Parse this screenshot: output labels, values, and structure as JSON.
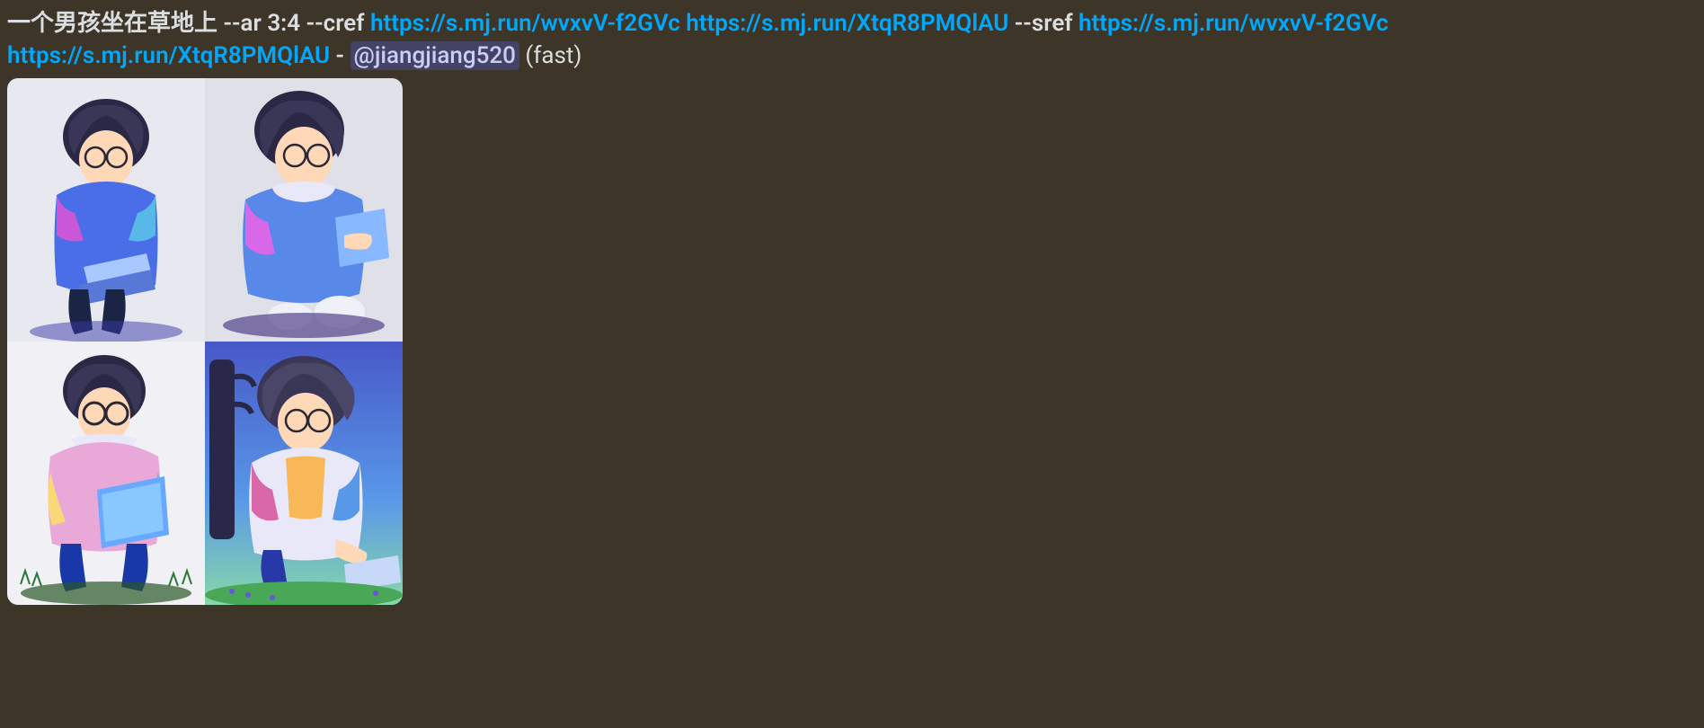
{
  "message": {
    "prompt_prefix": "一个男孩坐在草地上 --ar 3:4 --cref ",
    "link1": "https://s.mj.run/wvxvV-f2GVc",
    "link2": "https://s.mj.run/XtqR8PMQlAU",
    "sref_param": " --sref ",
    "link3": "https://s.mj.run/wvxvV-f2GVc",
    "link4": "https://s.mj.run/XtqR8PMQlAU",
    "separator": " - ",
    "mention": "@jiangjiang520",
    "mode": " (fast)"
  }
}
